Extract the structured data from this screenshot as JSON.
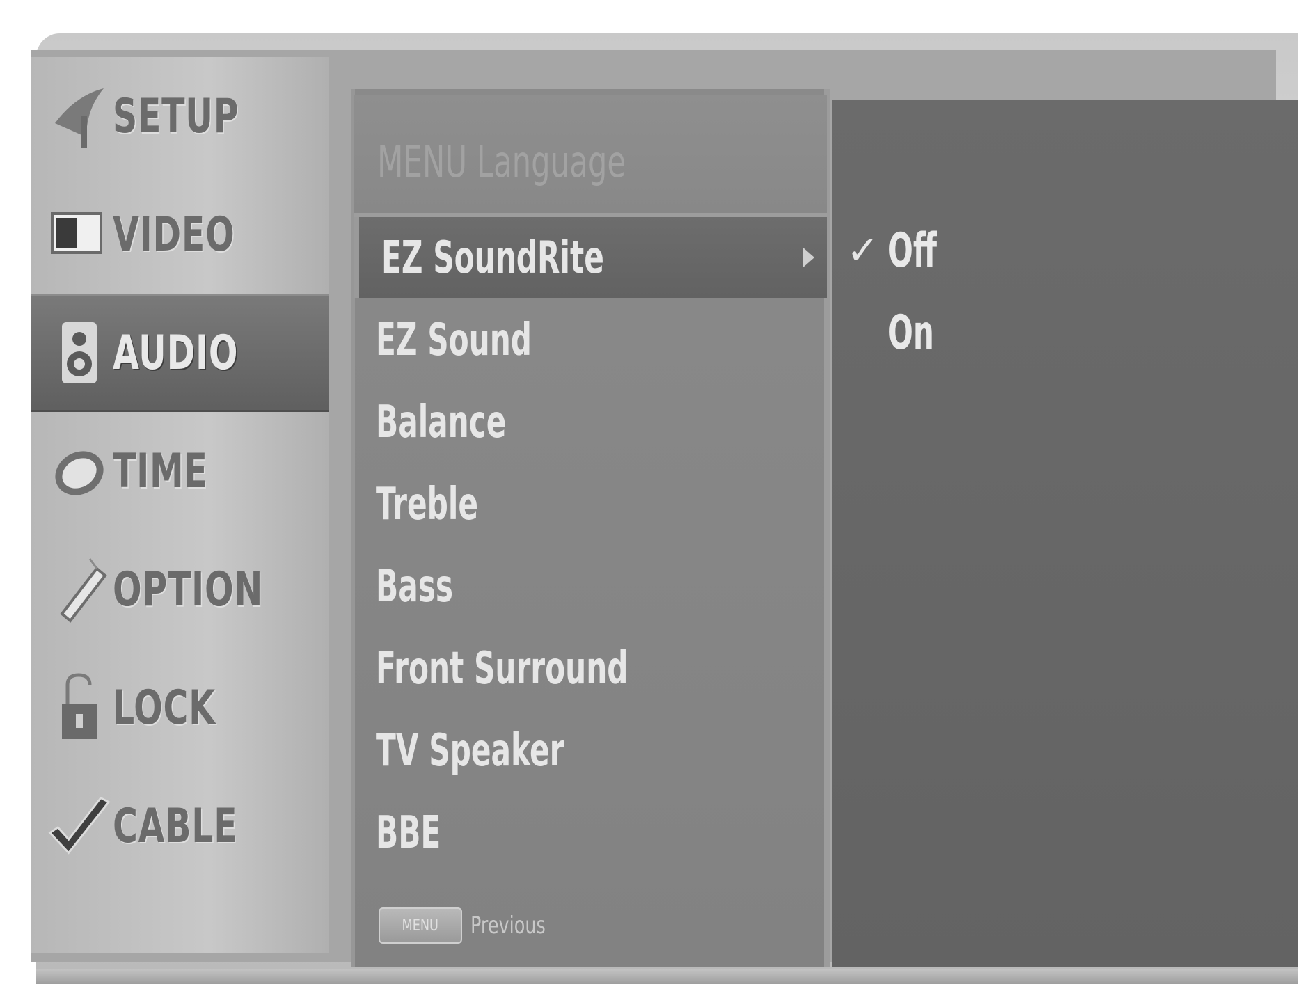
{
  "sidebar": {
    "items": [
      {
        "label": "SETUP",
        "icon": "satellite-dish-icon",
        "active": false
      },
      {
        "label": "VIDEO",
        "icon": "tv-screen-icon",
        "active": false
      },
      {
        "label": "AUDIO",
        "icon": "speaker-icon",
        "active": true
      },
      {
        "label": "TIME",
        "icon": "clock-icon",
        "active": false
      },
      {
        "label": "OPTION",
        "icon": "pen-icon",
        "active": false
      },
      {
        "label": "LOCK",
        "icon": "padlock-icon",
        "active": false
      },
      {
        "label": "CABLE",
        "icon": "checkmark-icon",
        "active": false
      }
    ]
  },
  "menu": {
    "header": "MENU Language",
    "items": [
      {
        "label": "EZ SoundRite",
        "selected": true
      },
      {
        "label": "EZ Sound",
        "selected": false
      },
      {
        "label": "Balance",
        "selected": false
      },
      {
        "label": "Treble",
        "selected": false
      },
      {
        "label": "Bass",
        "selected": false
      },
      {
        "label": "Front Surround",
        "selected": false
      },
      {
        "label": "TV Speaker",
        "selected": false
      },
      {
        "label": "BBE",
        "selected": false
      }
    ],
    "footer": {
      "key_label": "MENU",
      "label": "Previous"
    }
  },
  "options": {
    "items": [
      {
        "label": "Off",
        "checked": true
      },
      {
        "label": "On",
        "checked": false
      }
    ],
    "check_glyph": "✓"
  }
}
